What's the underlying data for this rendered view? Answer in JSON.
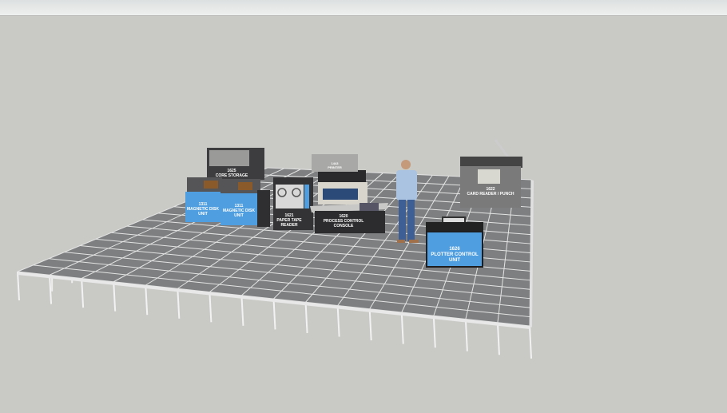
{
  "scene": {
    "machines": [
      {
        "id": "core",
        "label_num": "1625",
        "label_text": "CORE STORAGE"
      },
      {
        "id": "printer",
        "label_num": "1443",
        "label_text": "PRINTER"
      },
      {
        "id": "disk1",
        "label_num": "1311",
        "label_text": "MAGNETIC DISK",
        "label_text2": "UNIT"
      },
      {
        "id": "disk2",
        "label_num": "1311",
        "label_text": "MAGNETIC DISK",
        "label_text2": "UNIT"
      },
      {
        "id": "tape",
        "label_num": "1621",
        "label_text": "PAPER TAPE",
        "label_text2": "READER"
      },
      {
        "id": "console",
        "label_num": "1620",
        "label_text": "PROCESS CONTROL",
        "label_text2": "CONSOLE"
      },
      {
        "id": "card",
        "label_num": "1622",
        "label_text": "CARD READER / PUNCH"
      },
      {
        "id": "plotter",
        "label_num": "1626",
        "label_text": "PLOTTER CONTROL",
        "label_text2": "UNIT"
      }
    ],
    "colors": {
      "background": "#c9c9c6",
      "floor": "#7d7f80",
      "grid": "#e6e6e6",
      "panel_blue": "#4f9ee0",
      "cabinet": "#3a3a3c"
    }
  }
}
